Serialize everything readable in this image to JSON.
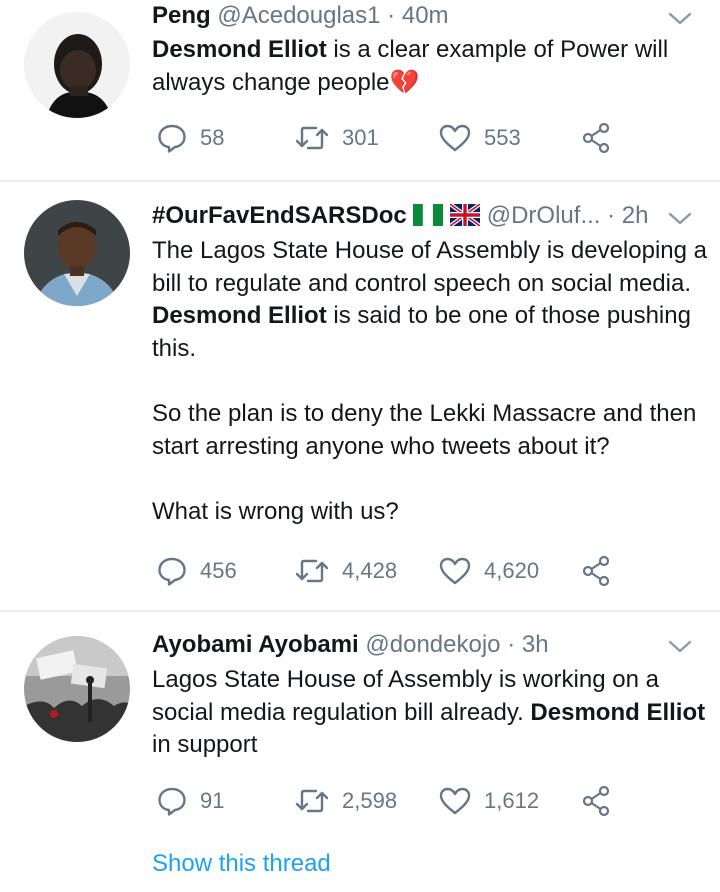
{
  "tweets": [
    {
      "name": "Peng",
      "handle": "@Acedouglas1",
      "sep": "·",
      "time": "40m",
      "body": [
        {
          "b": "Desmond Elliot"
        },
        {
          "t": " is a clear example of Power will always change people"
        }
      ],
      "emoji": "💔",
      "replies": "58",
      "retweets": "301",
      "likes": "553"
    },
    {
      "name": "#OurFavEndSARSDoc",
      "handle": "@DrOluf...",
      "sep": "·",
      "time": "2h",
      "flags": [
        "nigeria-flag",
        "uk-flag"
      ],
      "paragraphs": [
        [
          {
            "t": "The Lagos State House of Assembly is developing a bill to regulate and control speech on social media. "
          },
          {
            "b": "Desmond Elliot"
          },
          {
            "t": " is said to be one of those pushing this."
          }
        ],
        [
          {
            "t": "So the plan is to deny the Lekki Massacre and then start arresting anyone who tweets about it?"
          }
        ],
        [
          {
            "t": "What is wrong with us?"
          }
        ]
      ],
      "replies": "456",
      "retweets": "4,428",
      "likes": "4,620"
    },
    {
      "name": "Ayobami Ayobami",
      "handle": "@dondekojo",
      "sep": "·",
      "time": "3h",
      "body": [
        {
          "t": "Lagos State House of Assembly is working on a social media regulation bill already. "
        },
        {
          "b": "Desmond Elliot"
        },
        {
          "t": " in support"
        }
      ],
      "replies": "91",
      "retweets": "2,598",
      "likes": "1,612",
      "show_thread": "Show this thread"
    }
  ],
  "colors": {
    "text": "#14171a",
    "muted": "#657786",
    "link": "#1da1f2",
    "divider": "#e6ecf0"
  },
  "icons": [
    "reply-icon",
    "retweet-icon",
    "like-icon",
    "share-icon",
    "chevron-down-icon"
  ]
}
